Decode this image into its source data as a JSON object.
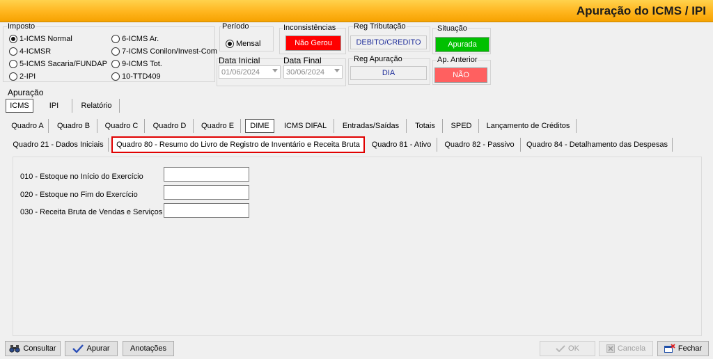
{
  "window": {
    "title": "Apuração do ICMS / IPI"
  },
  "imposto": {
    "label": "Imposto",
    "options": [
      {
        "label": "1-ICMS Normal",
        "selected": true
      },
      {
        "label": "4-ICMSR",
        "selected": false
      },
      {
        "label": "5-ICMS Sacaria/FUNDAP",
        "selected": false
      },
      {
        "label": "2-IPI",
        "selected": false
      },
      {
        "label": "6-ICMS Ar.",
        "selected": false
      },
      {
        "label": "7-ICMS Conilon/Invest-Com",
        "selected": false
      },
      {
        "label": "9-ICMS Tot.",
        "selected": false
      },
      {
        "label": "10-TTD409",
        "selected": false
      }
    ]
  },
  "periodo": {
    "label": "Período",
    "option": "Mensal",
    "data_inicial_label": "Data Inicial",
    "data_inicial": "01/06/2024",
    "data_final_label": "Data Final",
    "data_final": "30/06/2024"
  },
  "inconsistencias": {
    "label": "Inconsistências",
    "value": "Não Gerou",
    "color": "#ff0000"
  },
  "reg_tributacao": {
    "label": "Reg Tributação",
    "value": "DEBITO/CREDITO",
    "color": "#1f2e9a"
  },
  "situacao": {
    "label": "Situação",
    "value": "Apurada",
    "color": "#00c000"
  },
  "reg_apuracao": {
    "label": "Reg Apuração",
    "value": "DIA"
  },
  "ap_anterior": {
    "label": "Ap. Anterior",
    "value": "NÃO",
    "color": "#ff6060"
  },
  "apuracao": {
    "label": "Apuração",
    "tabs": [
      "ICMS",
      "IPI",
      "Relatório"
    ]
  },
  "quadro_tabs": [
    "Quadro A",
    "Quadro B",
    "Quadro C",
    "Quadro D",
    "Quadro E",
    "DIME",
    "ICMS DIFAL",
    "Entradas/Saídas",
    "Totais",
    "SPED",
    "Lançamento de Créditos"
  ],
  "dime_tabs": [
    "Quadro 21 - Dados Iniciais",
    "Quadro 80 - Resumo do Livro de Registro de Inventário e Receita Bruta",
    "Quadro 81 - Ativo",
    "Quadro 82 - Passivo",
    "Quadro 84 - Detalhamento das Despesas"
  ],
  "fields": [
    {
      "label": "010 - Estoque no Início do Exercício",
      "value": ""
    },
    {
      "label": "020 - Estoque no Fim do Exercício",
      "value": ""
    },
    {
      "label": "030 - Receita Bruta de Vendas e Serviços",
      "value": ""
    }
  ],
  "buttons": {
    "consultar": "Consultar",
    "apurar": "Apurar",
    "anotacoes": "Anotações",
    "ok": "OK",
    "cancela": "Cancela",
    "fecha": "Fechar"
  },
  "highlight_color": "#e00000"
}
